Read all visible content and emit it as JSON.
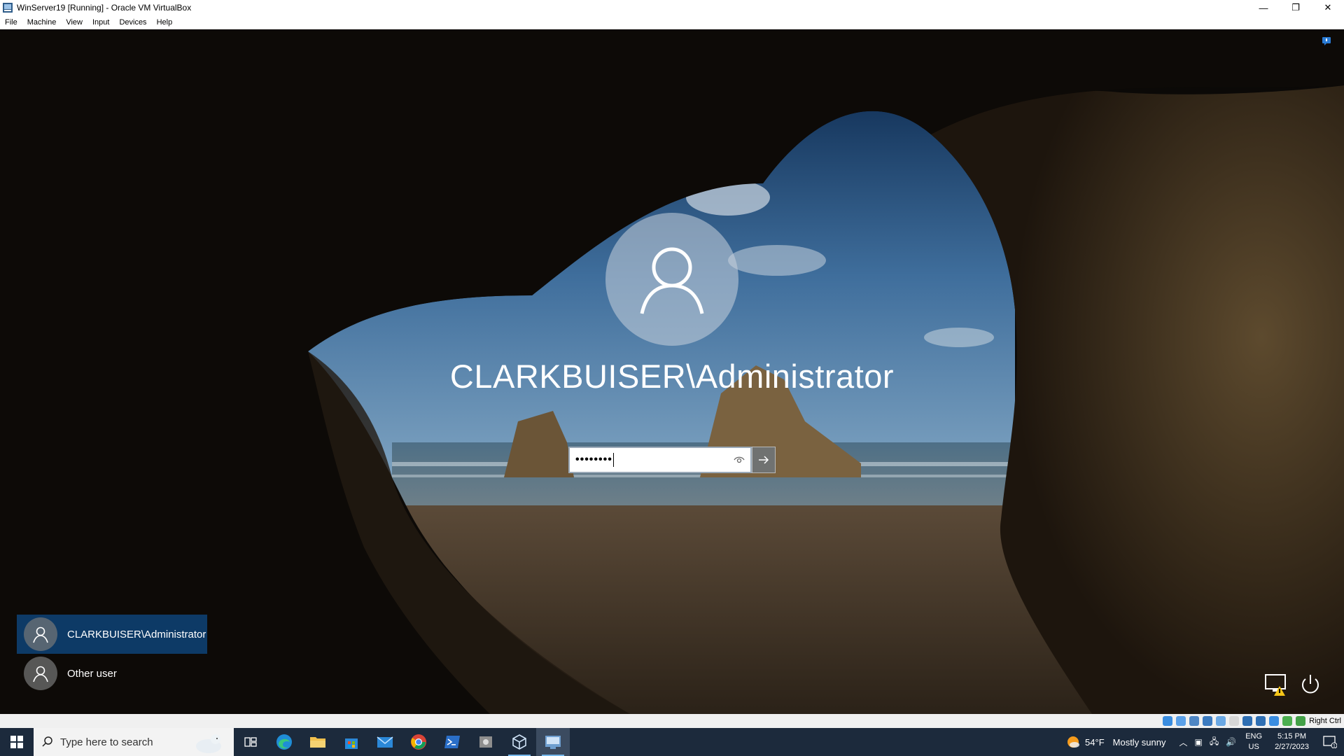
{
  "window": {
    "title": "WinServer19 [Running] - Oracle VM VirtualBox",
    "controls": {
      "minimize": "—",
      "restore": "❐",
      "close": "✕"
    }
  },
  "menubar": {
    "items": [
      "File",
      "Machine",
      "View",
      "Input",
      "Devices",
      "Help"
    ]
  },
  "login": {
    "user_display": "CLARKBUISER\\Administrator",
    "password_mask": "••••••••",
    "password_filled_chars": 8,
    "user_tiles": [
      {
        "label": "CLARKBUISER\\Administrator",
        "selected": true
      },
      {
        "label": "Other user",
        "selected": false
      }
    ]
  },
  "vbox_status": {
    "host_key": "Right Ctrl"
  },
  "taskbar": {
    "search_placeholder": "Type here to search",
    "pinned": [
      "task-view",
      "edge",
      "file-explorer",
      "store",
      "mail",
      "chrome",
      "powershell",
      "tool",
      "virtualbox",
      "server-manager"
    ],
    "weather": {
      "temp": "54°F",
      "condition": "Mostly sunny"
    },
    "lang": {
      "line1": "ENG",
      "line2": "US"
    },
    "clock": {
      "time": "5:15 PM",
      "date": "2/27/2023"
    },
    "notifications_count": "1"
  },
  "colors": {
    "selected_tile": "#0d3a66",
    "taskbar": "#1c2a3c",
    "accent": "#76b9ed"
  }
}
